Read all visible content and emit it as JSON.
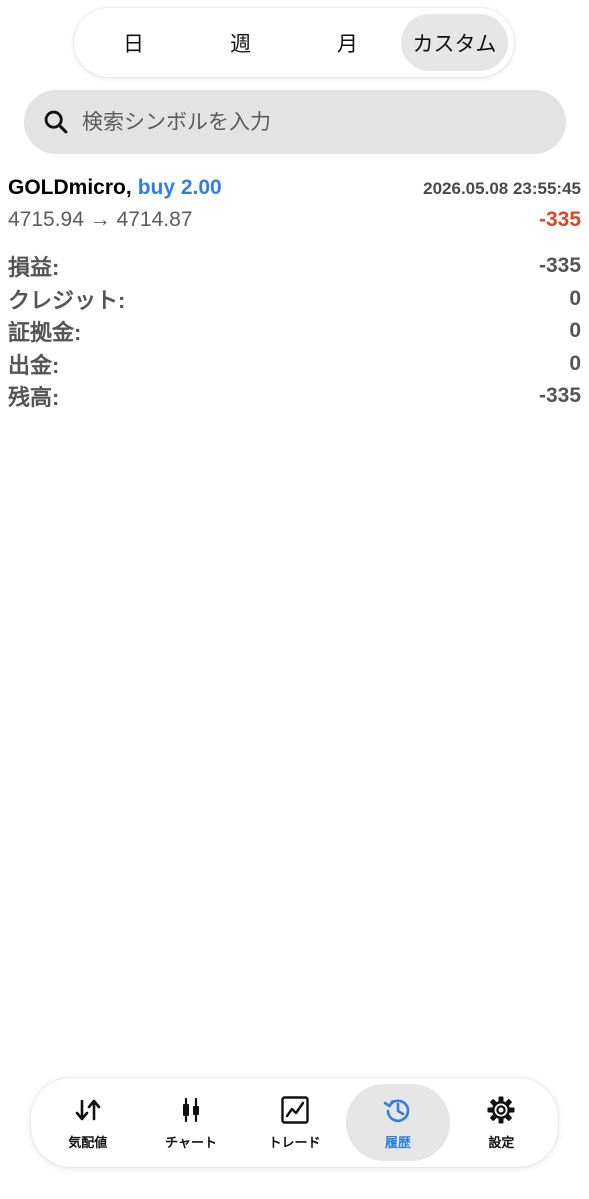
{
  "periods": {
    "day": "日",
    "week": "週",
    "month": "月",
    "custom": "カスタム",
    "selected": "カスタム"
  },
  "search": {
    "placeholder": "検索シンボルを入力",
    "icon": "search-icon"
  },
  "deal": {
    "symbol": "GOLDmicro,",
    "side": "buy 2.00",
    "datetime": "2026.05.08 23:55:45",
    "prices": "4715.94 → 4714.87",
    "profit": "-335"
  },
  "details": [
    {
      "label": "損益:",
      "value": "-335"
    },
    {
      "label": "クレジット:",
      "value": "0"
    },
    {
      "label": "証拠金:",
      "value": "0"
    },
    {
      "label": "出金:",
      "value": "0"
    },
    {
      "label": "残高:",
      "value": "-335"
    }
  ],
  "nav": {
    "items": [
      {
        "label": "気配値",
        "icon": "arrows-up-down-icon"
      },
      {
        "label": "チャート",
        "icon": "candlestick-icon"
      },
      {
        "label": "トレード",
        "icon": "trend-line-icon"
      },
      {
        "label": "履歴",
        "icon": "history-icon"
      },
      {
        "label": "設定",
        "icon": "gear-icon"
      }
    ],
    "selected": "履歴"
  },
  "colors": {
    "accent": "#2f7fe0",
    "loss": "#d8472a",
    "active_bg": "#e6e6e6",
    "search_bg": "#e3e3e3"
  }
}
